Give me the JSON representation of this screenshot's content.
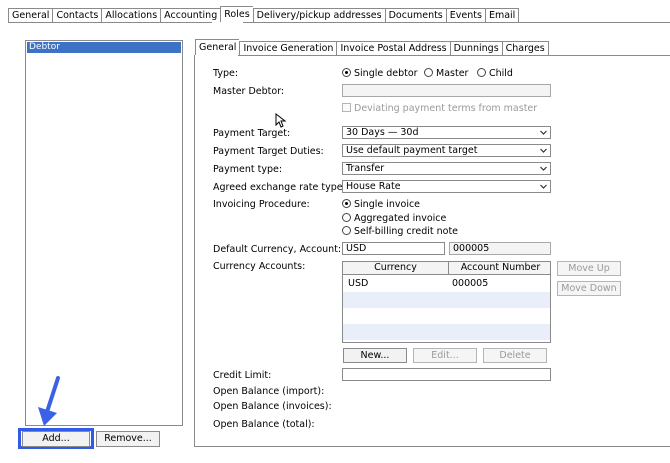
{
  "top_tabs": [
    "General",
    "Contacts",
    "Allocations",
    "Accounting",
    "Roles",
    "Delivery/pickup addresses",
    "Documents",
    "Events",
    "Email"
  ],
  "active_top_tab": "Roles",
  "left_list": {
    "items": [
      "Debtor"
    ],
    "add_button": "Add...",
    "remove_button": "Remove..."
  },
  "sub_tabs": [
    "General",
    "Invoice Generation",
    "Invoice Postal Address",
    "Dunnings",
    "Charges"
  ],
  "active_sub_tab": "General",
  "form": {
    "type_label": "Type:",
    "type_options": [
      "Single debtor",
      "Master",
      "Child"
    ],
    "type_selected": "Single debtor",
    "master_debtor_label": "Master Debtor:",
    "master_debtor_value": "",
    "deviating_terms_label": "Deviating payment terms from master",
    "payment_target_label": "Payment Target:",
    "payment_target_value": "30 Days — 30d",
    "payment_target_duties_label": "Payment Target Duties:",
    "payment_target_duties_value": "Use default payment target",
    "payment_type_label": "Payment type:",
    "payment_type_value": "Transfer",
    "exchange_rate_label": "Agreed exchange rate type:",
    "exchange_rate_value": "House Rate",
    "invoicing_label": "Invoicing Procedure:",
    "invoicing_options": [
      "Single invoice",
      "Aggregated invoice",
      "Self-billing credit note"
    ],
    "invoicing_selected": "Single invoice",
    "default_currency_label": "Default Currency, Account:",
    "default_currency_value": "USD",
    "default_account_value": "000005",
    "currency_accounts_label": "Currency Accounts:",
    "table_headers": [
      "Currency",
      "Account Number"
    ],
    "table_rows": [
      [
        "USD",
        "000005"
      ]
    ],
    "move_up": "Move Up",
    "move_down": "Move Down",
    "new_button": "New...",
    "edit_button": "Edit...",
    "delete_button": "Delete",
    "credit_limit_label": "Credit Limit:",
    "credit_limit_value": "",
    "open_balance_import_label": "Open Balance (import):",
    "open_balance_invoices_label": "Open Balance (invoices):",
    "open_balance_total_label": "Open Balance (total):"
  },
  "colors": {
    "selection": "#3d72c6",
    "highlight": "#2f5be8",
    "arrow": "#3b62e6"
  }
}
